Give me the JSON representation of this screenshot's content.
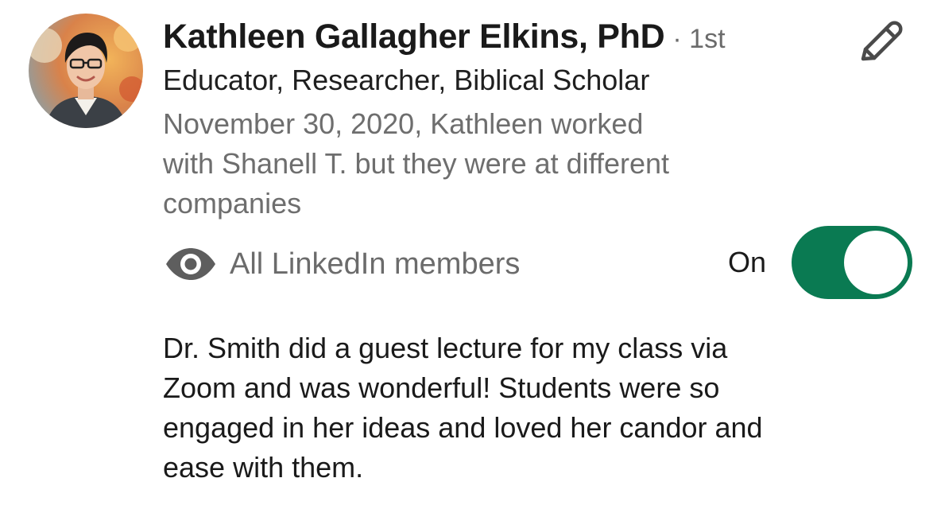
{
  "recommendation": {
    "author": {
      "name": "Kathleen Gallagher Elkins, PhD",
      "degree": "· 1st",
      "headline": "Educator, Researcher, Biblical Scholar",
      "relationship_lines": [
        "November 30, 2020, Kathleen worked",
        "with Shanell T. but they were at different",
        "companies"
      ]
    },
    "visibility": {
      "icon": "eye-icon",
      "label": "All LinkedIn members",
      "toggle_label": "On",
      "toggle_state": true,
      "toggle_color": "#0a7a52"
    },
    "edit_icon": "pencil-icon",
    "text_lines": [
      "Dr. Smith did a guest lecture for my class via",
      "Zoom and was wonderful! Students were so",
      "engaged in her ideas and loved her candor and",
      "ease with them."
    ]
  }
}
